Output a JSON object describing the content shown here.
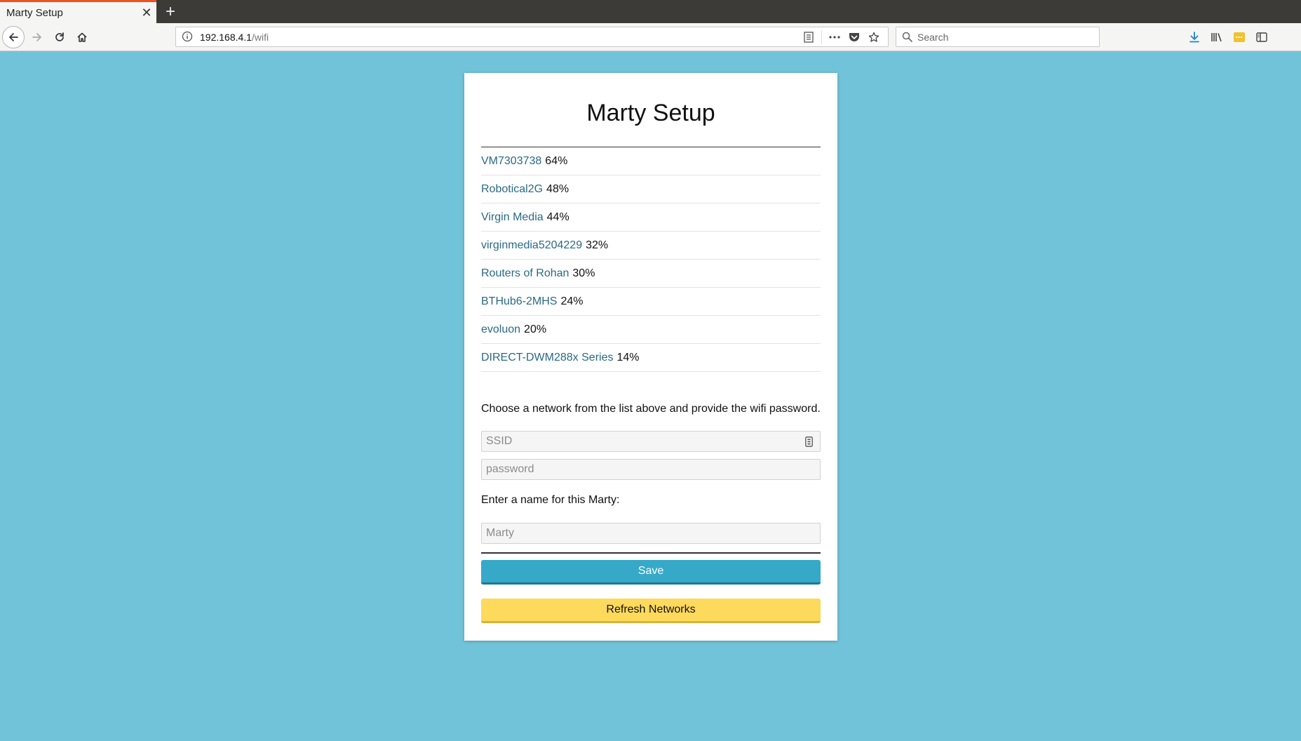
{
  "browser": {
    "tab_title": "Marty Setup",
    "tab_close": "✕",
    "new_tab": "+",
    "url_host": "192.168.4.1",
    "url_path": "/wifi",
    "search_placeholder": "Search"
  },
  "page": {
    "title": "Marty Setup",
    "networks": [
      {
        "name": "VM7303738",
        "signal": "64%"
      },
      {
        "name": "Robotical2G",
        "signal": "48%"
      },
      {
        "name": "Virgin Media",
        "signal": "44%"
      },
      {
        "name": "virginmedia5204229",
        "signal": "32%"
      },
      {
        "name": "Routers of Rohan",
        "signal": "30%"
      },
      {
        "name": "BTHub6-2MHS",
        "signal": "24%"
      },
      {
        "name": "evoluon",
        "signal": "20%"
      },
      {
        "name": "DIRECT-DWM288x Series",
        "signal": "14%"
      }
    ],
    "instructions": "Choose a network from the list above and provide the wifi password.",
    "ssid_placeholder": "SSID",
    "password_placeholder": "password",
    "name_label": "Enter a name for this Marty:",
    "name_placeholder": "Marty",
    "save_label": "Save",
    "refresh_label": "Refresh Networks"
  },
  "colors": {
    "page_background": "#71c3d9",
    "link": "#2a6a86",
    "save_button": "#36a9c9",
    "refresh_button": "#fdd95c",
    "tab_accent": "#e95420"
  }
}
